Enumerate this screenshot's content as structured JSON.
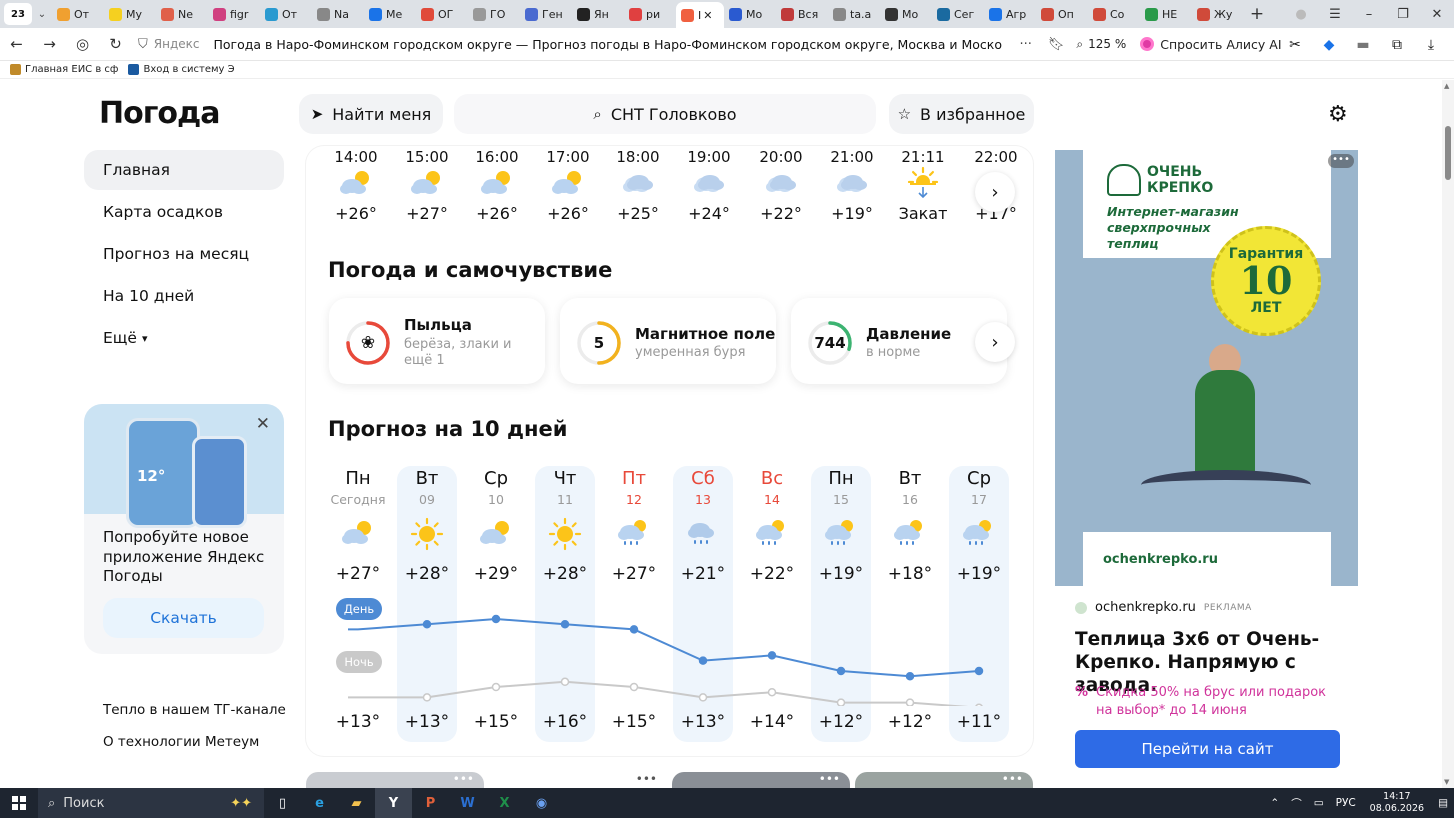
{
  "browser": {
    "tab_count": "23",
    "tabs": [
      {
        "label": "От",
        "color": "#f0a030"
      },
      {
        "label": "My",
        "color": "#f5d020"
      },
      {
        "label": "Ne",
        "color": "#e0604a"
      },
      {
        "label": "figr",
        "color": "#d04080"
      },
      {
        "label": "От",
        "color": "#2a9ad0"
      },
      {
        "label": "Na",
        "color": "#888888"
      },
      {
        "label": "Ме",
        "color": "#1a73e8"
      },
      {
        "label": "ОГ",
        "color": "#e04a3a"
      },
      {
        "label": "ГО",
        "color": "#999999"
      },
      {
        "label": "Ген",
        "color": "#4a6ad0"
      },
      {
        "label": "Ян",
        "color": "#222222"
      },
      {
        "label": "ри",
        "color": "#e04040"
      },
      {
        "label": "I",
        "color": "#f06040",
        "active": true
      },
      {
        "label": "Мо",
        "color": "#2a5ad0"
      },
      {
        "label": "Вся",
        "color": "#c03a3a"
      },
      {
        "label": "ta.a",
        "color": "#888888"
      },
      {
        "label": "Мо",
        "color": "#333333"
      },
      {
        "label": "Сег",
        "color": "#1a6aa0"
      },
      {
        "label": "Агр",
        "color": "#1a73e8"
      },
      {
        "label": "Оп",
        "color": "#d04a3a"
      },
      {
        "label": "Со",
        "color": "#d04a3a"
      },
      {
        "label": "НЕ",
        "color": "#2a9a4a"
      },
      {
        "label": "Жу",
        "color": "#d04a3a"
      }
    ],
    "site_label": "Яндекс",
    "page_title": "Погода в Наро-Фоминском городском округе — Прогноз погоды в Наро-Фоминском городском округе, Москва и Московская область, Россия",
    "zoom": "125 %",
    "alice_label": "Спросить Алису AI",
    "bookmarks": [
      {
        "label": "Главная ЕИС в сф",
        "color": "#c08a2a"
      },
      {
        "label": "Вход в систему Э",
        "color": "#1a5aa0"
      }
    ]
  },
  "header": {
    "logo": "Погода",
    "find_me": "Найти меня",
    "location": "СНТ Головково",
    "favorite": "В избранное"
  },
  "sidenav": {
    "items": [
      "Главная",
      "Карта осадков",
      "Прогноз на месяц",
      "На 10 дней"
    ],
    "more": "Ещё"
  },
  "promo": {
    "phone_temp": "12°",
    "text": "Попробуйте новое приложение Яндекс Погоды",
    "button": "Скачать"
  },
  "footer_links": [
    "Тепло в нашем ТГ-канале",
    "О технологии Метеум"
  ],
  "hourly": [
    {
      "time": "14:00",
      "temp": "+26°",
      "icon": "partly-cloudy"
    },
    {
      "time": "15:00",
      "temp": "+27°",
      "icon": "partly-cloudy"
    },
    {
      "time": "16:00",
      "temp": "+26°",
      "icon": "partly-cloudy"
    },
    {
      "time": "17:00",
      "temp": "+26°",
      "icon": "partly-cloudy"
    },
    {
      "time": "18:00",
      "temp": "+25°",
      "icon": "cloudy"
    },
    {
      "time": "19:00",
      "temp": "+24°",
      "icon": "cloudy"
    },
    {
      "time": "20:00",
      "temp": "+22°",
      "icon": "cloudy"
    },
    {
      "time": "21:00",
      "temp": "+19°",
      "icon": "cloudy"
    },
    {
      "time": "21:11",
      "temp": "Закат",
      "icon": "sunset"
    },
    {
      "time": "22:00",
      "temp": "+17°",
      "icon": "cloudy"
    }
  ],
  "wellbeing": {
    "title": "Погода и самочувствие",
    "cards": [
      {
        "title": "Пыльца",
        "sub": "берёза, злаки и ещё 1",
        "value": "",
        "ring_color": "#e8493a",
        "level": 0.75
      },
      {
        "title": "Магнитное поле",
        "sub": "умеренная буря",
        "value": "5",
        "ring_color": "#f2b21e",
        "level": 0.5
      },
      {
        "title": "Давление",
        "sub": "в норме",
        "value": "744",
        "ring_color": "#3cb371",
        "level": 0.3
      }
    ]
  },
  "forecast": {
    "title": "Прогноз на 10 дней",
    "day_label": "День",
    "night_label": "Ночь",
    "days": [
      {
        "name": "Пн",
        "date": "Сегодня",
        "day": "+27°",
        "night": "+13°",
        "icon": "partly-cloudy",
        "weekend": false
      },
      {
        "name": "Вт",
        "date": "09",
        "day": "+28°",
        "night": "+13°",
        "icon": "sunny",
        "weekend": false
      },
      {
        "name": "Ср",
        "date": "10",
        "day": "+29°",
        "night": "+15°",
        "icon": "partly-cloudy",
        "weekend": false
      },
      {
        "name": "Чт",
        "date": "11",
        "day": "+28°",
        "night": "+16°",
        "icon": "sunny",
        "weekend": false
      },
      {
        "name": "Пт",
        "date": "12",
        "day": "+27°",
        "night": "+15°",
        "icon": "rain-sun",
        "weekend": true
      },
      {
        "name": "Сб",
        "date": "13",
        "day": "+21°",
        "night": "+13°",
        "icon": "rain",
        "weekend": true
      },
      {
        "name": "Вс",
        "date": "14",
        "day": "+22°",
        "night": "+14°",
        "icon": "rain-sun",
        "weekend": true
      },
      {
        "name": "Пн",
        "date": "15",
        "day": "+19°",
        "night": "+12°",
        "icon": "rain-sun",
        "weekend": false
      },
      {
        "name": "Вт",
        "date": "16",
        "day": "+18°",
        "night": "+12°",
        "icon": "rain-sun",
        "weekend": false
      },
      {
        "name": "Ср",
        "date": "17",
        "day": "+19°",
        "night": "+11°",
        "icon": "rain-sun",
        "weekend": false
      }
    ]
  },
  "ad": {
    "brand_line1": "ОЧЕНЬ",
    "brand_line2": "КРЕПКО",
    "tagline": "Интернет-магазин сверхпрочных теплиц",
    "badge_top": "Гарантия",
    "badge_num": "10",
    "badge_bottom": "ЛЕТ",
    "img_url": "ochenkrepko.ru",
    "source": "ochenkrepko.ru",
    "source_tag": "РЕКЛАМА",
    "title": "Теплица 3х6 от Очень-Крепко. Напрямую с завода.",
    "promo_icon": "%",
    "promo_line1": "Скидка 50% на брус или подарок",
    "promo_line2": "на выбор* до 14 июня",
    "cta": "Перейти на сайт"
  },
  "taskbar": {
    "search": "Поиск",
    "lang": "РУС",
    "time": "14:17",
    "date": "08.06.2026"
  }
}
